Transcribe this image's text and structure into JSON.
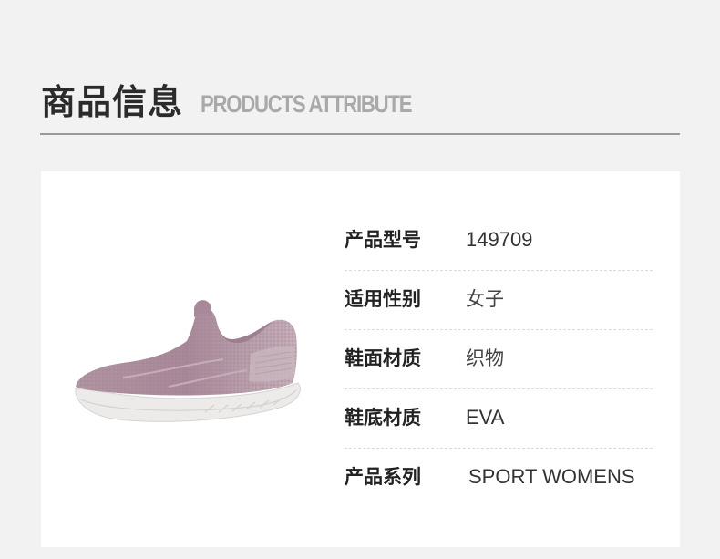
{
  "header": {
    "title_cn": "商品信息",
    "title_en": "PRODUCTS ATTRIBUTE"
  },
  "product_image": {
    "description_icon": "shoe-image",
    "color": "#b59aa6"
  },
  "attributes": [
    {
      "label": "产品型号",
      "value": "149709"
    },
    {
      "label": "适用性别",
      "value": "女子"
    },
    {
      "label": "鞋面材质",
      "value": "织物"
    },
    {
      "label": "鞋底材质",
      "value": "EVA"
    },
    {
      "label": "产品系列",
      "value": "SPORT WOMENS"
    }
  ],
  "colors": {
    "background": "#f2f2f2",
    "card": "#ffffff",
    "title": "#2b2b2b",
    "subtitle": "#a9a9a9",
    "divider": "#9a9a9a"
  }
}
